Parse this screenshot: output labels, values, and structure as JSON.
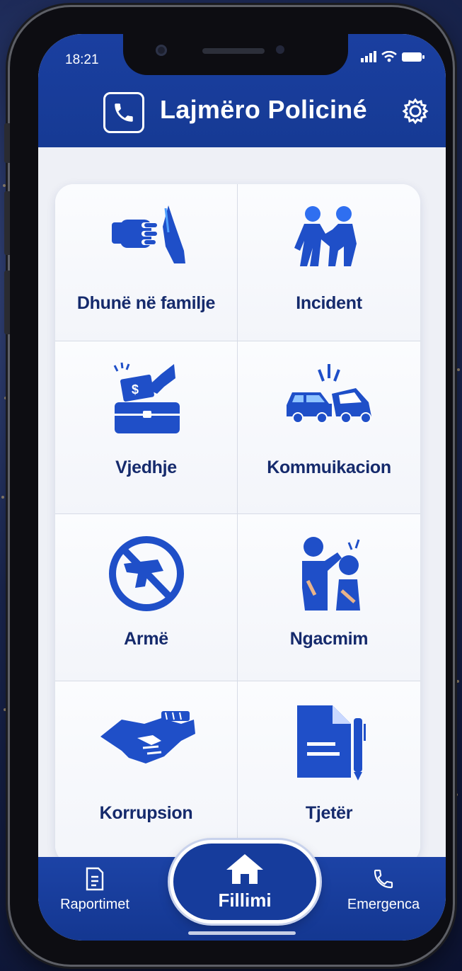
{
  "status_bar": {
    "time": "18:21",
    "signal": "signal-icon",
    "wifi": "wifi-icon",
    "battery": "battery-icon"
  },
  "header": {
    "title": "Lajmëro Policiné",
    "phone_icon": "phone-icon",
    "settings_icon": "gear-icon"
  },
  "categories": [
    {
      "label": "Dhunë në familje",
      "icon": "domestic-violence-icon"
    },
    {
      "label": "Incident",
      "icon": "incident-icon"
    },
    {
      "label": "Vjedhje",
      "icon": "theft-icon"
    },
    {
      "label": "Kommuikacion",
      "icon": "car-crash-icon"
    },
    {
      "label": "Armë",
      "icon": "no-weapon-icon"
    },
    {
      "label": "Ngacmim",
      "icon": "harassment-icon"
    },
    {
      "label": "Korrupsion",
      "icon": "bribe-handshake-icon"
    },
    {
      "label": "Tjetër",
      "icon": "document-icon"
    }
  ],
  "bottom_nav": {
    "reports": {
      "label": "Raportimet",
      "icon": "report-icon"
    },
    "home": {
      "label": "Fillimi",
      "icon": "home-icon"
    },
    "emergency": {
      "label": "Emergenca",
      "icon": "phone-icon"
    }
  },
  "colors": {
    "primary": "#1a3fa0",
    "icon_blue": "#1f4fc8",
    "text_dark": "#152a6c",
    "background": "#eef0f6"
  }
}
